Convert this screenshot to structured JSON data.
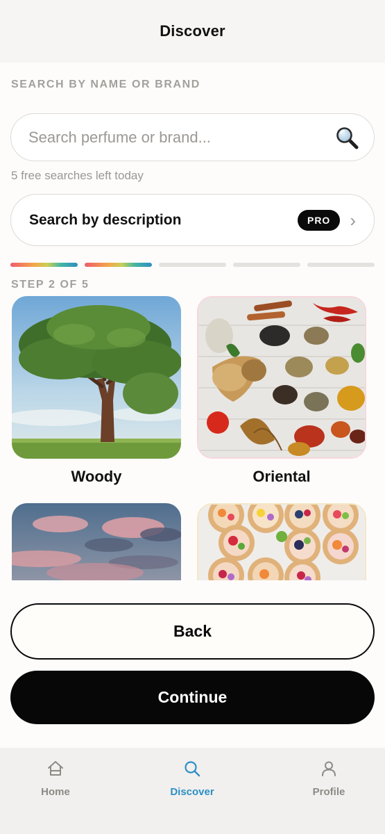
{
  "header": {
    "title": "Discover"
  },
  "search": {
    "section_label": "SEARCH BY NAME OR BRAND",
    "placeholder": "Search perfume or brand...",
    "value": "",
    "free_searches_text": "5 free searches left today",
    "icon": "magnifier-icon"
  },
  "description_search": {
    "label": "Search by description",
    "badge": "PRO",
    "icon": "chevron-right-icon"
  },
  "progress": {
    "current_step": 2,
    "total_steps": 5,
    "step_label": "STEP 2 OF 5",
    "accent_gradient": [
      "#ef5c6e",
      "#f3a64b",
      "#c9cf55",
      "#42b6a3",
      "#2f8fc2"
    ]
  },
  "categories": [
    {
      "name": "Woody",
      "image": "tree-in-field"
    },
    {
      "name": "Oriental",
      "image": "spices-on-table"
    },
    {
      "name": "",
      "image": "pink-cloudy-sky"
    },
    {
      "name": "",
      "image": "fruit-tarts"
    }
  ],
  "buttons": {
    "back": "Back",
    "continue": "Continue"
  },
  "tabbar": {
    "items": [
      {
        "label": "Home",
        "icon": "home-icon",
        "active": false
      },
      {
        "label": "Discover",
        "icon": "search-icon",
        "active": true
      },
      {
        "label": "Profile",
        "icon": "person-icon",
        "active": false
      }
    ],
    "active_color": "#2c8fc6",
    "inactive_color": "#8d8a86"
  }
}
